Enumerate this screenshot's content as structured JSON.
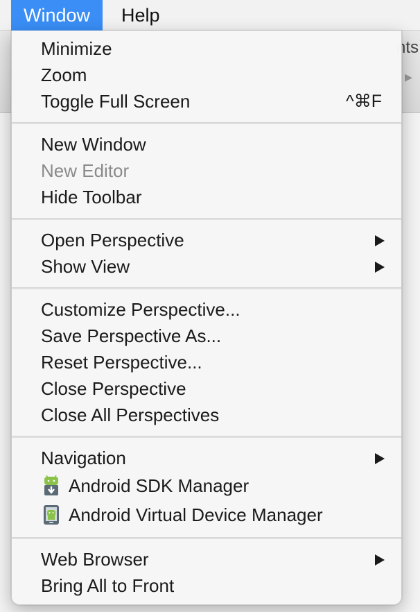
{
  "menubar": {
    "items": [
      {
        "label": "Window"
      },
      {
        "label": "Help"
      }
    ]
  },
  "background": {
    "tab_text": "nts"
  },
  "menu": {
    "group1": {
      "minimize": "Minimize",
      "zoom": "Zoom",
      "toggle_full_screen": "Toggle Full Screen",
      "toggle_full_screen_shortcut": "^⌘F"
    },
    "group2": {
      "new_window": "New Window",
      "new_editor": "New Editor",
      "hide_toolbar": "Hide Toolbar"
    },
    "group3": {
      "open_perspective": "Open Perspective",
      "show_view": "Show View"
    },
    "group4": {
      "customize_perspective": "Customize Perspective...",
      "save_perspective_as": "Save Perspective As...",
      "reset_perspective": "Reset Perspective...",
      "close_perspective": "Close Perspective",
      "close_all_perspectives": "Close All Perspectives"
    },
    "group5": {
      "navigation": "Navigation",
      "android_sdk_manager": "Android SDK Manager",
      "android_avd_manager": "Android Virtual Device Manager"
    },
    "group6": {
      "web_browser": "Web Browser",
      "bring_all_to_front": "Bring All to Front"
    }
  },
  "icons": {
    "submenu": "chevron-right-icon",
    "sdk_manager": "android-download-icon",
    "avd_manager": "android-device-icon"
  },
  "colors": {
    "menubar_active": "#3a8ef6",
    "disabled_text": "#8a8a8a",
    "android_green": "#8bc34a"
  }
}
